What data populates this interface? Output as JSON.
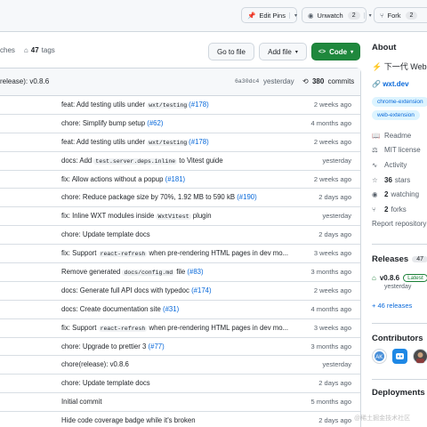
{
  "topbar": {
    "edit_pins": "Edit Pins",
    "unwatch": "Unwatch",
    "unwatch_count": "2",
    "fork": "Fork",
    "fork_count": "2"
  },
  "branch_row": {
    "branches_fragment": "ches",
    "tags_count": "47",
    "tags_label": "tags",
    "go_to_file": "Go to file",
    "add_file": "Add file",
    "code": "Code"
  },
  "latest_commit": {
    "message": "release): v0.8.6",
    "sha": "6a30dc4",
    "time": "yesterday",
    "commit_count": "380",
    "commits_label": "commits"
  },
  "commits": [
    {
      "msg": "feat: Add testing utils under ",
      "code": "wxt/testing",
      "pr": "(#178)",
      "time": "2 weeks ago"
    },
    {
      "msg": "chore: Simplify bump setup ",
      "code": "",
      "pr": "(#62)",
      "time": "4 months ago"
    },
    {
      "msg": "feat: Add testing utils under ",
      "code": "wxt/testing",
      "pr": "(#178)",
      "time": "2 weeks ago"
    },
    {
      "msg": "docs: Add ",
      "code": "test.server.deps.inline",
      "pr": "",
      "tail": " to Vitest guide",
      "time": "yesterday"
    },
    {
      "msg": "fix: Allow actions without a popup ",
      "code": "",
      "pr": "(#181)",
      "time": "2 weeks ago"
    },
    {
      "msg": "chore: Reduce package size by 70%, 1.92 MB to 590 kB ",
      "code": "",
      "pr": "(#190)",
      "time": "2 days ago"
    },
    {
      "msg": "fix: Inline WXT modules inside ",
      "code": "WxtVitest",
      "pr": "",
      "tail": " plugin",
      "time": "yesterday"
    },
    {
      "msg": "chore: Update template docs",
      "code": "",
      "pr": "",
      "time": "2 days ago"
    },
    {
      "msg": "fix: Support ",
      "code": "react-refresh",
      "pr": "",
      "tail": " when pre-rendering HTML pages in dev mo...",
      "time": "3 weeks ago"
    },
    {
      "msg": "Remove generated ",
      "code": "docs/config.md",
      "pr": "(#83)",
      "tail": " file ",
      "time": "3 months ago"
    },
    {
      "msg": "docs: Generate full API docs with typedoc ",
      "code": "",
      "pr": "(#174)",
      "time": "2 weeks ago"
    },
    {
      "msg": "docs: Create documentation site ",
      "code": "",
      "pr": "(#31)",
      "time": "4 months ago"
    },
    {
      "msg": "fix: Support ",
      "code": "react-refresh",
      "pr": "",
      "tail": " when pre-rendering HTML pages in dev mo...",
      "time": "3 weeks ago"
    },
    {
      "msg": "chore: Upgrade to prettier 3 ",
      "code": "",
      "pr": "(#77)",
      "time": "3 months ago"
    },
    {
      "msg": "chore(release): v0.8.6",
      "code": "",
      "pr": "",
      "time": "yesterday"
    },
    {
      "msg": "chore: Update template docs",
      "code": "",
      "pr": "",
      "time": "2 days ago"
    },
    {
      "msg": "Initial commit",
      "code": "",
      "pr": "",
      "time": "5 months ago"
    },
    {
      "msg": "Hide code coverage badge while it's broken",
      "code": "",
      "pr": "",
      "time": "2 days ago"
    }
  ],
  "sidebar": {
    "about_title": "About",
    "description": "下一代 Web",
    "website": "wxt.dev",
    "topics": [
      "chrome-extension",
      "web-extension"
    ],
    "readme": "Readme",
    "license": "MIT license",
    "activity": "Activity",
    "stars_count": "36",
    "stars_label": "stars",
    "watching_count": "2",
    "watching_label": "watching",
    "forks_count": "2",
    "forks_label": "forks",
    "report": "Report repository",
    "releases_title": "Releases",
    "releases_count": "47",
    "release_version": "v0.8.6",
    "release_badge": "Latest",
    "release_time": "yesterday",
    "more_releases": "+ 46 releases",
    "contributors_title": "Contributors",
    "deployments_title": "Deployments"
  },
  "watermark": "@稀土掘金技术社区",
  "colors": {
    "accent": "#0969da",
    "green": "#1f883d",
    "border": "#d0d7de"
  }
}
